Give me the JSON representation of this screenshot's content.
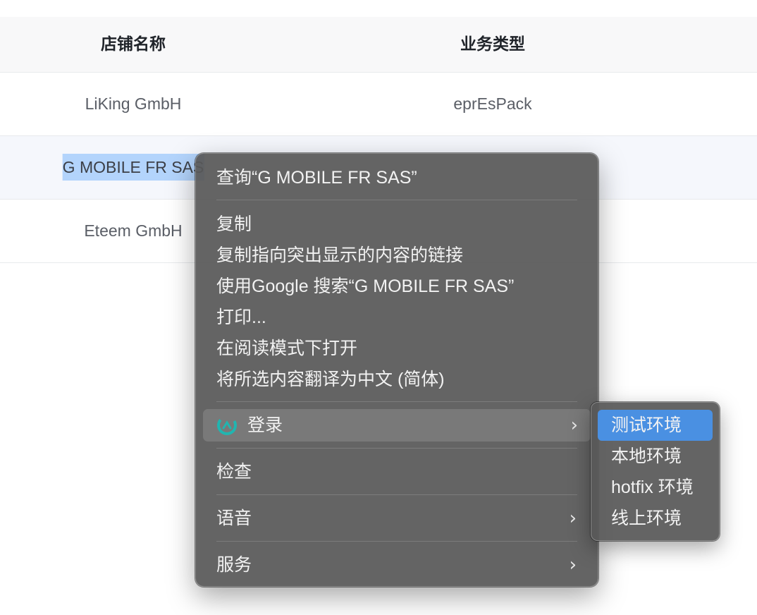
{
  "table": {
    "columns": [
      "店铺名称",
      "业务类型"
    ],
    "rows": [
      {
        "shop": "LiKing GmbH",
        "type": "eprEsPack"
      },
      {
        "shop": "G MOBILE FR SAS",
        "type": ""
      },
      {
        "shop": "Eteem GmbH",
        "type": ""
      }
    ]
  },
  "context_menu": {
    "lookup": "查询“G MOBILE FR SAS”",
    "copy": "复制",
    "copy_link": "复制指向突出显示的内容的链接",
    "search_google": "使用Google 搜索“G MOBILE FR SAS”",
    "print": "打印...",
    "reader_mode": "在阅读模式下打开",
    "translate": "将所选内容翻译为中文 (简体)",
    "login": "登录",
    "inspect": "检查",
    "speech": "语音",
    "services": "服务",
    "chevron": "›",
    "login_icon": "extension-app-icon"
  },
  "submenu": {
    "items": [
      "测试环境",
      "本地环境",
      "hotfix 环境",
      "线上环境"
    ],
    "highlight_color": "#4a90e2"
  }
}
